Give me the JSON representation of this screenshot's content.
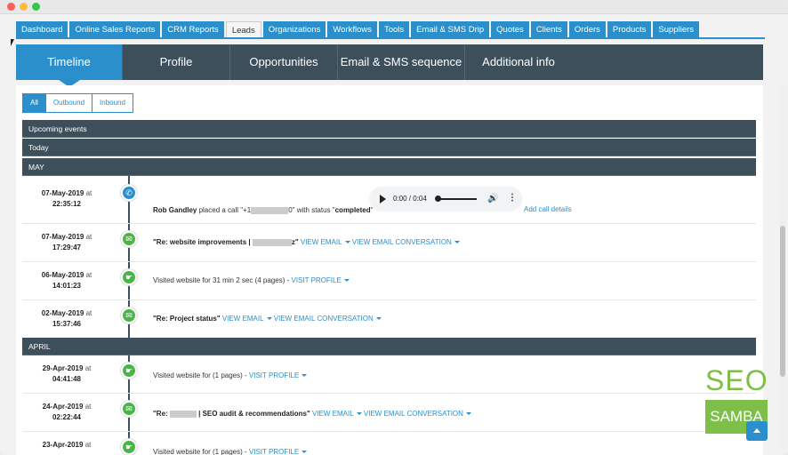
{
  "window": {
    "controls": [
      "close",
      "minimize",
      "zoom"
    ]
  },
  "top_nav": [
    "Dashboard",
    "Online Sales Reports",
    "CRM Reports",
    "Leads",
    "Organizations",
    "Workflows",
    "Tools",
    "Email & SMS Drip",
    "Quotes",
    "Clients",
    "Orders",
    "Products",
    "Suppliers"
  ],
  "top_nav_active": "Leads",
  "sub_nav": [
    "Timeline",
    "Profile",
    "Opportunities",
    "Email & SMS sequence",
    "Additional info"
  ],
  "sub_nav_active": "Timeline",
  "filters": [
    "All",
    "Outbound",
    "Inbound"
  ],
  "filters_active": "All",
  "sections": {
    "upcoming": "Upcoming events",
    "today": "Today",
    "may": "MAY",
    "april": "APRIL"
  },
  "events": [
    {
      "date": "07-May-2019",
      "at": "at",
      "time": "22:35:12",
      "icon": "phone-icon",
      "actor": "Rob Gandley",
      "text_1": " placed a call \"+1",
      "text_2": "0\" with status \"",
      "status": "completed",
      "text_3": "\"",
      "player_time": "0:00 / 0:04",
      "add_details": "Add call details"
    },
    {
      "date": "07-May-2019",
      "at": "at",
      "time": "17:29:47",
      "icon": "email-icon",
      "subject_prefix": "\"Re: website improvements | ",
      "subject_suffix": "z\"",
      "link_1": "VIEW EMAIL",
      "link_2": "VIEW EMAIL CONVERSATION"
    },
    {
      "date": "06-May-2019",
      "at": "at",
      "time": "14:01:23",
      "icon": "visit-icon",
      "text": "Visited website for 31 min 2 sec (4 pages) - ",
      "link_1": "VISIT PROFILE"
    },
    {
      "date": "02-May-2019",
      "at": "at",
      "time": "15:37:46",
      "icon": "email-icon",
      "subject": "\"Re: Project status\"",
      "link_1": "VIEW EMAIL",
      "link_2": "VIEW EMAIL CONVERSATION"
    },
    {
      "date": "29-Apr-2019",
      "at": "at",
      "time": "04:41:48",
      "icon": "visit-icon",
      "text": "Visited website for (1 pages) - ",
      "link_1": "VISIT PROFILE"
    },
    {
      "date": "24-Apr-2019",
      "at": "at",
      "time": "02:22:44",
      "icon": "email-icon",
      "subject_prefix": "\"Re: ",
      "subject_suffix": " | SEO audit & recommendations\"",
      "link_1": "VIEW EMAIL",
      "link_2": "VIEW EMAIL CONVERSATION"
    },
    {
      "date": "23-Apr-2019",
      "at": "at",
      "text": "Visited website for (1 pages) - ",
      "link_1": "VISIT PROFILE",
      "icon": "visit-icon"
    }
  ],
  "logo": {
    "line_1": "SEO",
    "line_2": "SAMBA"
  },
  "colors": {
    "accent": "#2b8fcb",
    "dark_bar": "#3e4f5c",
    "green": "#4cb54a",
    "logo_green": "#7dbf48"
  }
}
